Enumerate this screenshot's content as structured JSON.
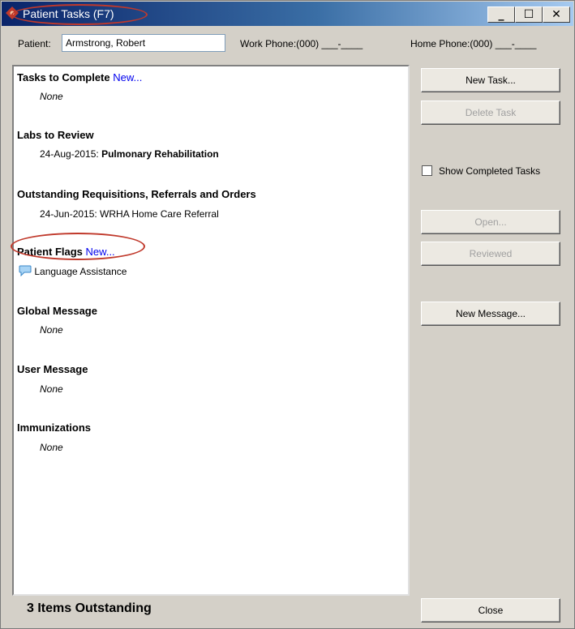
{
  "window": {
    "title": "Patient Tasks (F7)",
    "controls": {
      "minimize": "_",
      "maximize": "☐",
      "close": "✕"
    }
  },
  "patient_bar": {
    "patient_label": "Patient:",
    "patient_name": "Armstrong, Robert",
    "work_phone": "Work Phone:(000) ___-____",
    "home_phone": "Home Phone:(000) ___-____"
  },
  "sections": {
    "tasks": {
      "title": "Tasks to Complete",
      "new_link": "New...",
      "item": "None"
    },
    "labs": {
      "title": "Labs to Review",
      "date": "24-Aug-2015:",
      "item": "Pulmonary Rehabilitation"
    },
    "reqs": {
      "title": "Outstanding Requisitions, Referrals and Orders",
      "item": "24-Jun-2015: WRHA Home Care Referral"
    },
    "flags": {
      "title": "Patient Flags",
      "new_link": "New...",
      "item": "Language Assistance"
    },
    "global": {
      "title": "Global Message",
      "item": "None"
    },
    "user": {
      "title": "User Message",
      "item": "None"
    },
    "immun": {
      "title": "Immunizations",
      "item": "None"
    }
  },
  "buttons": {
    "new_task": "New Task...",
    "delete_task": "Delete Task",
    "show_completed": "Show Completed Tasks",
    "open": "Open...",
    "reviewed": "Reviewed",
    "new_message": "New Message...",
    "close": "Close"
  },
  "status": "3 Items Outstanding",
  "colors": {
    "title_bar": "#0a246a",
    "annotation": "#c0392b",
    "link": "#0000ee"
  }
}
